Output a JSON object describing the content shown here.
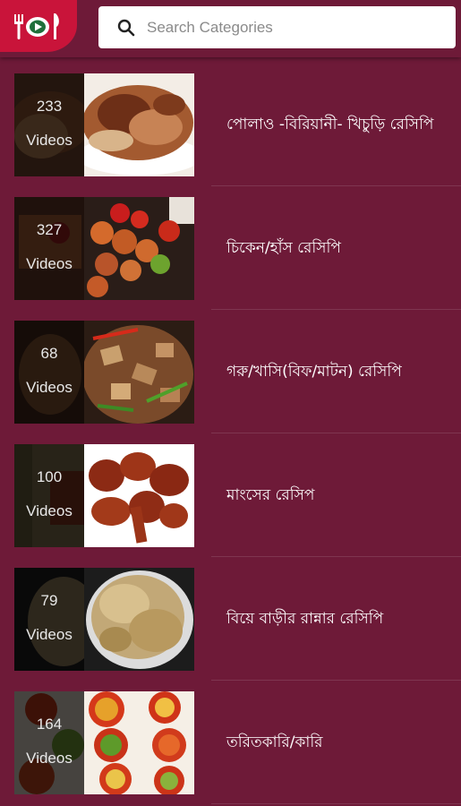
{
  "search": {
    "placeholder": "Search Categories"
  },
  "icons": {
    "logo": "plate-fork-knife-play-icon",
    "search": "search-icon"
  },
  "colors": {
    "background": "#6e1a38",
    "logo": "#c9143a"
  },
  "categories": [
    {
      "count": "233",
      "count_label": "Videos",
      "title": "পোলাও -বিরিয়ানী- খিচুড়ি রেসিপি"
    },
    {
      "count": "327",
      "count_label": "Videos",
      "title": "চিকেন/হাঁস রেসিপি"
    },
    {
      "count": "68",
      "count_label": "Videos",
      "title": "গরু/খাসি(বিফ/মাটন) রেসিপি"
    },
    {
      "count": "100",
      "count_label": "Videos",
      "title": "মাংসের রেসিপ"
    },
    {
      "count": "79",
      "count_label": "Videos",
      "title": "বিয়ে বাড়ীর রান্নার রেসিপি"
    },
    {
      "count": "164",
      "count_label": "Videos",
      "title": "তরিতকারি/কারি"
    }
  ]
}
